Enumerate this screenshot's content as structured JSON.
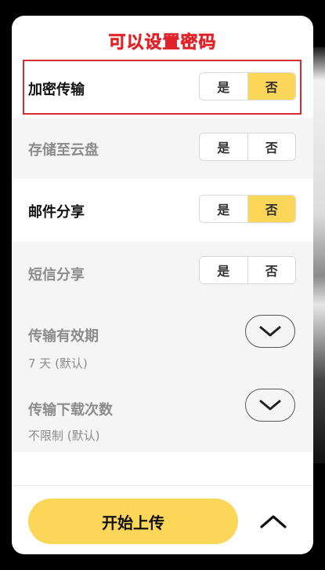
{
  "annotation": "可以设置密码",
  "options": [
    {
      "label": "加密传输",
      "yes": "是",
      "no": "否",
      "selected": "no"
    },
    {
      "label": "存储至云盘",
      "yes": "是",
      "no": "否",
      "selected": "none"
    },
    {
      "label": "邮件分享",
      "yes": "是",
      "no": "否",
      "selected": "no"
    },
    {
      "label": "短信分享",
      "yes": "是",
      "no": "否",
      "selected": "none"
    }
  ],
  "expiry": {
    "label": "传输有效期",
    "value": "7 天 (默认)"
  },
  "download_limit": {
    "label": "传输下载次数",
    "value": "不限制 (默认)"
  },
  "footer": {
    "start_label": "开始上传"
  },
  "colors": {
    "accent": "#fcd659",
    "annotation": "#e0242b"
  },
  "icons": [
    "chevron-down-icon",
    "chevron-down-icon",
    "chevron-up-icon"
  ]
}
